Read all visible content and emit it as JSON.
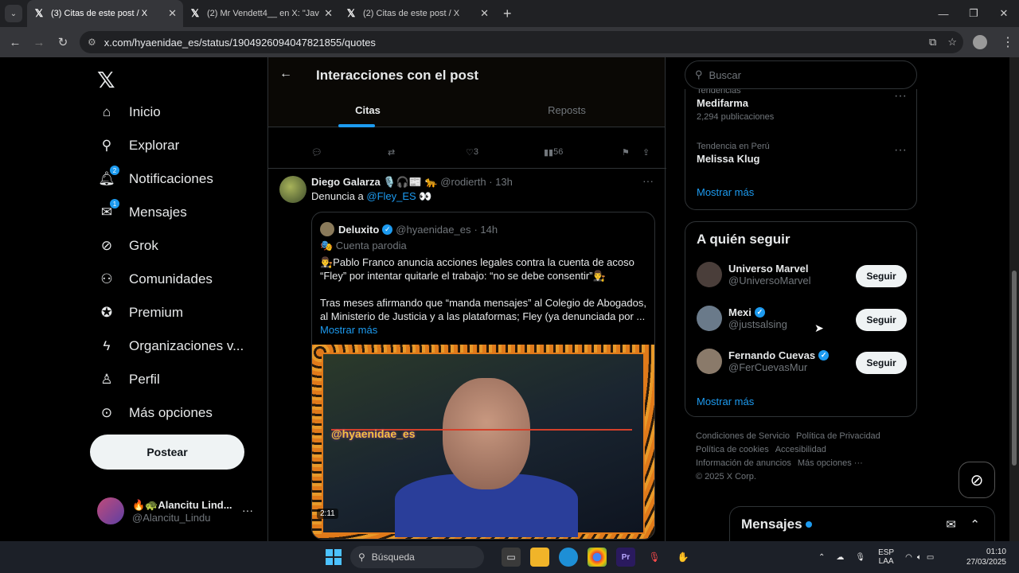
{
  "browser": {
    "tabs": [
      {
        "title": "(3) Citas de este post / X",
        "active": true
      },
      {
        "title": "(2) Mr Vendett4__ en X: \"Javier",
        "active": false
      },
      {
        "title": "(2) Citas de este post / X",
        "active": false
      }
    ],
    "url": "x.com/hyaenidae_es/status/1904926094047821855/quotes"
  },
  "nav": {
    "items": [
      {
        "label": "Inicio",
        "icon": "home-icon"
      },
      {
        "label": "Explorar",
        "icon": "search-icon"
      },
      {
        "label": "Notificaciones",
        "icon": "bell-icon",
        "badge": "2"
      },
      {
        "label": "Mensajes",
        "icon": "mail-icon",
        "badge": "1"
      },
      {
        "label": "Grok",
        "icon": "grok-icon"
      },
      {
        "label": "Comunidades",
        "icon": "people-icon"
      },
      {
        "label": "Premium",
        "icon": "verified-icon"
      },
      {
        "label": "Organizaciones v...",
        "icon": "lightning-icon"
      },
      {
        "label": "Perfil",
        "icon": "person-icon"
      },
      {
        "label": "Más opciones",
        "icon": "more-circle-icon"
      }
    ],
    "post_label": "Postear",
    "account": {
      "name": "🔥🐢Alancitu Lind...",
      "handle": "@Alancitu_Lindu"
    }
  },
  "header": {
    "title": "Interacciones con el post",
    "tabs": [
      "Citas",
      "Reposts"
    ]
  },
  "prev_post_actions": {
    "likes": "3",
    "views": "56"
  },
  "post": {
    "author": "Diego Galarza 🎙️🎧📰 🐆",
    "handle": "@rodierth",
    "time": "· 13h",
    "text_prefix": "Denuncia a ",
    "mention": "@Fley_ES",
    "text_suffix": " 👀",
    "quote": {
      "author": "Deluxito",
      "handle": "@hyaenidae_es",
      "time": "· 14h",
      "parody": "🎭 Cuenta parodia",
      "para1": "👨‍⚖️Pablo Franco anuncia acciones legales contra la cuenta de acoso “Fley” por intentar quitarle el trabajo: “no se debe consentir”👨‍⚖️",
      "para2": "Tras meses afirmando que “manda mensajes” al Colegio de Abogados, al Ministerio de Justicia y a las plataformas; Fley (ya denunciada por ...",
      "show_more": "Mostrar más",
      "media": {
        "watermark": "@hyaenidae_es",
        "duration": "2:11"
      }
    }
  },
  "right": {
    "search_placeholder": "Buscar",
    "trends": [
      {
        "category": "Tendencias",
        "title": "Medifarma",
        "count": "2,294 publicaciones"
      },
      {
        "category": "Tendencia en Perú",
        "title": "Melissa Klug",
        "count": ""
      }
    ],
    "trends_more": "Mostrar más",
    "who_to_follow": {
      "heading": "A quién seguir",
      "users": [
        {
          "name": "Universo Marvel",
          "handle": "@UniversoMarvel",
          "verified": false
        },
        {
          "name": "Mexi",
          "handle": "@justsalsing",
          "verified": true
        },
        {
          "name": "Fernando Cuevas",
          "handle": "@FerCuevasMur",
          "verified": true
        }
      ],
      "follow_label": "Seguir",
      "more": "Mostrar más"
    },
    "footer": {
      "links": [
        "Condiciones de Servicio",
        "Política de Privacidad",
        "Política de cookies",
        "Accesibilidad",
        "Información de anuncios",
        "Más opciones ···"
      ],
      "copyright": "© 2025 X Corp."
    }
  },
  "messages_drawer": {
    "title": "Mensajes"
  },
  "taskbar": {
    "search": "Búsqueda",
    "lang": "ESP",
    "lang2": "LAA",
    "time": "01:10",
    "date": "27/03/2025"
  }
}
